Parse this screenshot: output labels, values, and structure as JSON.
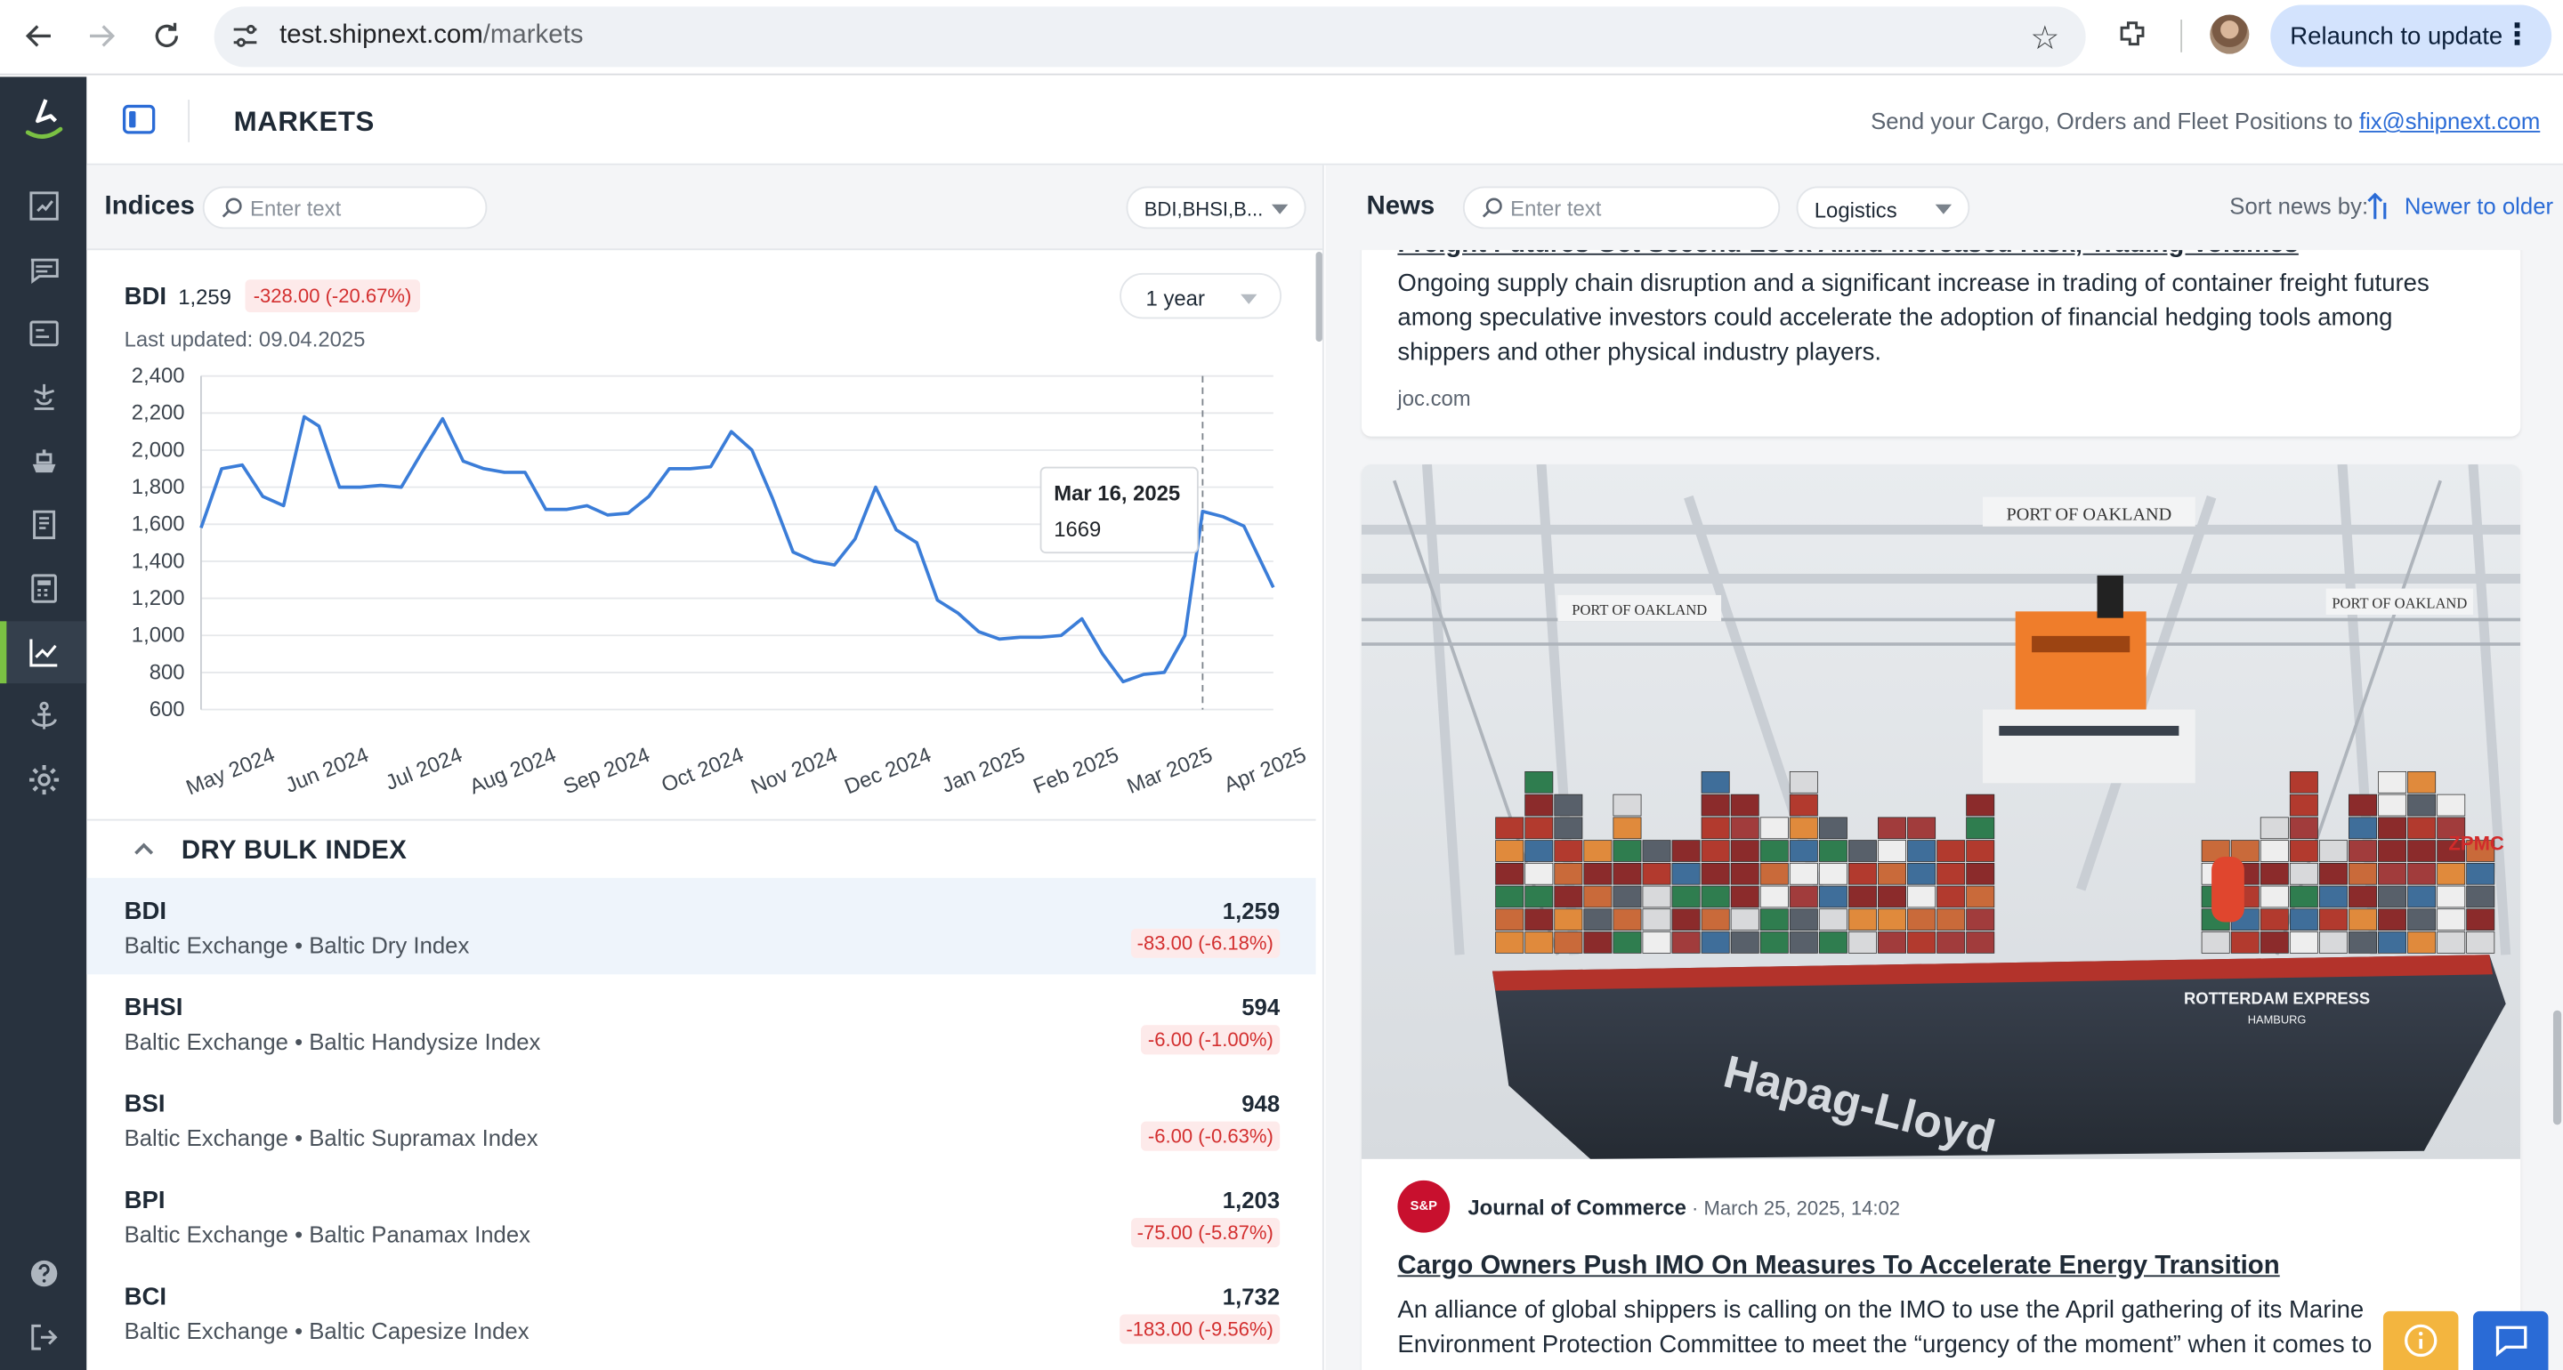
{
  "browser": {
    "url_host": "test.shipnext.com",
    "url_path": "/markets",
    "relaunch_label": "Relaunch to update"
  },
  "header": {
    "title": "MARKETS",
    "send_info": "Send your Cargo, Orders and Fleet Positions to",
    "email": "fix@shipnext.com"
  },
  "indices": {
    "label": "Indices",
    "search_placeholder": "Enter text",
    "selected_indices": "BDI,BHSI,B..."
  },
  "chart_card": {
    "symbol": "BDI",
    "price": "1,259",
    "change": "-328.00 (-20.67%)",
    "last_updated": "Last updated: 09.04.2025",
    "period": "1 year",
    "tooltip_date": "Mar 16, 2025",
    "tooltip_value": "1669"
  },
  "chart_data": {
    "type": "line",
    "series": [
      {
        "color": "#3b7dd8",
        "x": [
          "2024-04-10",
          "2024-04-17",
          "2024-04-24",
          "2024-05-01",
          "2024-05-08",
          "2024-05-15",
          "2024-05-20",
          "2024-05-27",
          "2024-06-03",
          "2024-06-10",
          "2024-06-17",
          "2024-06-24",
          "2024-07-01",
          "2024-07-08",
          "2024-07-15",
          "2024-07-22",
          "2024-07-29",
          "2024-08-05",
          "2024-08-12",
          "2024-08-19",
          "2024-08-26",
          "2024-09-02",
          "2024-09-09",
          "2024-09-16",
          "2024-09-23",
          "2024-09-30",
          "2024-10-07",
          "2024-10-14",
          "2024-10-21",
          "2024-10-28",
          "2024-11-04",
          "2024-11-11",
          "2024-11-18",
          "2024-11-25",
          "2024-12-02",
          "2024-12-09",
          "2024-12-16",
          "2024-12-23",
          "2024-12-30",
          "2025-01-06",
          "2025-01-13",
          "2025-01-20",
          "2025-01-27",
          "2025-02-03",
          "2025-02-10",
          "2025-02-17",
          "2025-02-24",
          "2025-03-03",
          "2025-03-10",
          "2025-03-16",
          "2025-03-23",
          "2025-03-30",
          "2025-04-09"
        ],
        "values": [
          1580,
          1900,
          1920,
          1750,
          1700,
          2180,
          2130,
          1800,
          1800,
          1810,
          1800,
          1990,
          2170,
          1940,
          1900,
          1880,
          1880,
          1680,
          1680,
          1700,
          1650,
          1660,
          1750,
          1900,
          1900,
          1910,
          2100,
          2000,
          1740,
          1450,
          1400,
          1380,
          1520,
          1800,
          1570,
          1500,
          1190,
          1120,
          1020,
          980,
          990,
          990,
          1000,
          1090,
          900,
          750,
          790,
          800,
          1000,
          1669,
          1640,
          1590,
          1259
        ]
      }
    ],
    "x_tick_labels": [
      "May 2024",
      "Jun 2024",
      "Jul 2024",
      "Aug 2024",
      "Sep 2024",
      "Oct 2024",
      "Nov 2024",
      "Dec 2024",
      "Jan 2025",
      "Feb 2025",
      "Mar 2025",
      "Apr 2025"
    ],
    "y_tick_labels": [
      "2,400",
      "2,200",
      "2,000",
      "1,800",
      "1,600",
      "1,400",
      "1,200",
      "1,000",
      "800",
      "600"
    ],
    "ylim": [
      600,
      2400
    ],
    "grid": true,
    "title": "",
    "xlabel": "",
    "ylabel": ""
  },
  "dry_bulk": {
    "title": "DRY BULK INDEX",
    "rows": [
      {
        "symbol": "BDI",
        "desc": "Baltic Exchange • Baltic Dry Index",
        "value": "1,259",
        "change": "-83.00 (-6.18%)"
      },
      {
        "symbol": "BHSI",
        "desc": "Baltic Exchange • Baltic Handysize Index",
        "value": "594",
        "change": "-6.00 (-1.00%)"
      },
      {
        "symbol": "BSI",
        "desc": "Baltic Exchange • Baltic Supramax Index",
        "value": "948",
        "change": "-6.00 (-0.63%)"
      },
      {
        "symbol": "BPI",
        "desc": "Baltic Exchange • Baltic Panamax Index",
        "value": "1,203",
        "change": "-75.00 (-5.87%)"
      },
      {
        "symbol": "BCI",
        "desc": "Baltic Exchange • Baltic Capesize Index",
        "value": "1,732",
        "change": "-183.00 (-9.56%)"
      }
    ]
  },
  "news": {
    "label": "News",
    "search_placeholder": "Enter text",
    "category": "Logistics",
    "sort_label": "Sort news by:",
    "sort_value": "Newer to older",
    "card1": {
      "title_cut": "Freight Futures Get Second Look Amid Increased Risk, Trading Volumes",
      "body": "Ongoing supply chain disruption and a significant increase in trading of container freight futures among speculative investors could accelerate the adoption of financial hedging tools among shippers and other physical industry players.",
      "source": "joc.com"
    },
    "card2": {
      "image_labels": {
        "port1": "PORT OF OAKLAND",
        "port2": "PORT OF OAKLAND",
        "port3": "PORT OF OAKLAND",
        "ship": "ROTTERDAM EXPRESS",
        "home": "HAMBURG",
        "line": "Hapag-Lloyd",
        "zpmc": "ZPMC"
      },
      "publisher_logo": "S&P",
      "publisher": "Journal of Commerce",
      "date": "· March 25, 2025, 14:02",
      "title": "Cargo Owners Push IMO On Measures To Accelerate Energy Transition",
      "body": "An alliance of global shippers is calling on the IMO to use the April gathering of its Marine Environment Protection Committee to meet the “urgency of the moment” when it comes to"
    }
  },
  "colors": {
    "sidebar": "#28323e",
    "accent_green": "#7ac143",
    "link_blue": "#2a6bd6",
    "negative_red": "#d32f2f",
    "line_blue": "#3b7dd8"
  }
}
